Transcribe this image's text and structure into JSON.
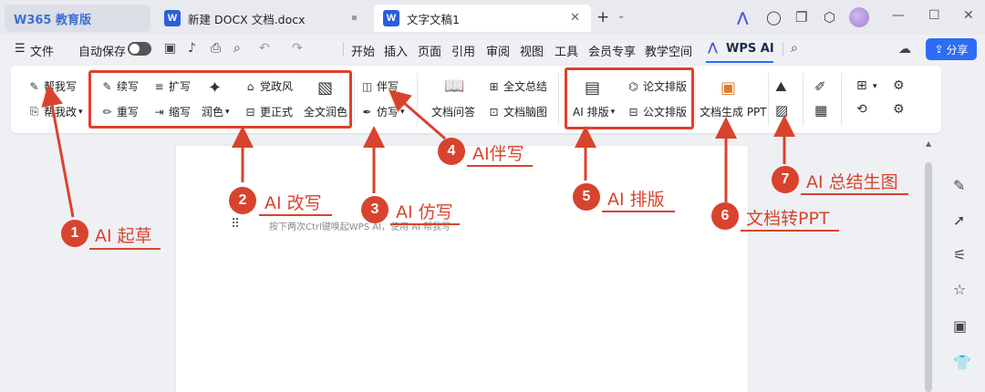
{
  "tabs": {
    "logo_text": "W365 教育版",
    "doc1": "新建 DOCX 文档.docx",
    "doc2": "文字文稿1"
  },
  "menu": {
    "file": "文件",
    "autosave": "自动保存",
    "items": [
      "开始",
      "插入",
      "页面",
      "引用",
      "审阅",
      "视图",
      "工具",
      "会员专享",
      "教学空间"
    ],
    "wps_ai": "WPS AI",
    "share": "分享"
  },
  "ribbon": {
    "help_write": "帮我写",
    "help_edit": "帮我改",
    "continue_write": "续写",
    "expand_write": "扩写",
    "party_style": "党政风",
    "rewrite": "重写",
    "shorten": "缩写",
    "polish": "润色",
    "more_formal": "更正式",
    "full_polish": "全文润色",
    "companion_write": "伴写",
    "imitate_write": "仿写",
    "doc_qa": "文档问答",
    "full_summary": "全文总结",
    "doc_mindmap": "文档脑图",
    "ai_layout": "AI 排版",
    "paper_layout": "论文排版",
    "official_layout": "公文排版",
    "doc_to_ppt": "文档生成 PPT"
  },
  "document": {
    "hint": "按下两次Ctrl键唤起WPS AI，使用 AI 帮我写"
  },
  "annotations": [
    {
      "num": "1",
      "label": "AI 起草"
    },
    {
      "num": "2",
      "label": "AI 改写"
    },
    {
      "num": "3",
      "label": "AI 仿写"
    },
    {
      "num": "4",
      "label": "AI伴写"
    },
    {
      "num": "5",
      "label": "AI 排版"
    },
    {
      "num": "6",
      "label": "文档转PPT"
    },
    {
      "num": "7",
      "label": "AI 总结生图"
    }
  ],
  "colors": {
    "annotation": "#d8432e",
    "accent": "#2f6cf6"
  }
}
